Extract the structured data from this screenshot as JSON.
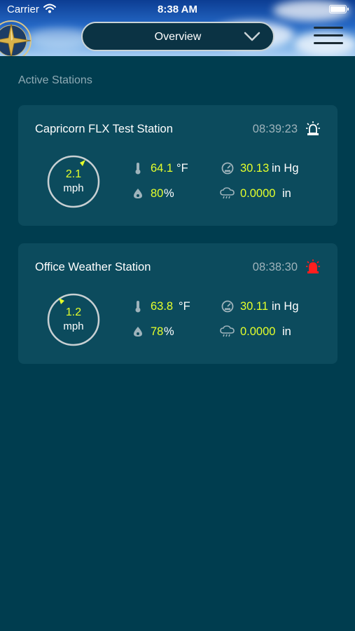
{
  "status_bar": {
    "carrier": "Carrier",
    "time": "8:38 AM"
  },
  "header": {
    "view_selector": "Overview"
  },
  "section_title": "Active Stations",
  "colors": {
    "value_accent": "#e4ff2b",
    "alarm_active": "#ff1e1e",
    "background": "#003d4f",
    "card": "#0c4b5d"
  },
  "stations": [
    {
      "name": "Capricorn FLX Test Station",
      "time": "08:39:23",
      "alarm_icon": "alarm-light-icon",
      "wind_speed": "2.1",
      "wind_unit": "mph",
      "temperature": "64.1",
      "temperature_unit": "°F",
      "humidity": "80",
      "humidity_unit": "%",
      "pressure": "30.13",
      "pressure_unit": "in Hg",
      "rain": "0.0000",
      "rain_unit": "in"
    },
    {
      "name": "Office Weather Station",
      "time": "08:38:30",
      "alarm_icon": "alarm-light-icon",
      "wind_speed": "1.2",
      "wind_unit": "mph",
      "temperature": "63.8",
      "temperature_unit": "°F",
      "humidity": "78",
      "humidity_unit": "%",
      "pressure": "30.11",
      "pressure_unit": "in Hg",
      "rain": "0.0000",
      "rain_unit": "in"
    }
  ]
}
